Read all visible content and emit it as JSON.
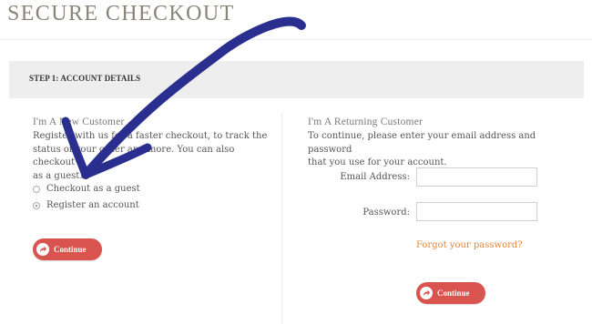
{
  "page": {
    "title": "SECURE CHECKOUT"
  },
  "step": {
    "label": "STEP 1: ACCOUNT DETAILS"
  },
  "new_customer": {
    "heading": "I'm A New Customer",
    "text_line1": "Register with us for a faster checkout, to track the",
    "text_line2": "status of your order and more. You can also checkout",
    "text_line3": "as a guest.",
    "options": [
      {
        "label": "Checkout as a guest",
        "checked": false
      },
      {
        "label": "Register an account",
        "checked": true
      }
    ],
    "continue_label": "Continue"
  },
  "returning_customer": {
    "heading": "I'm A Returning Customer",
    "text_line1": "To continue, please enter your email address and password",
    "text_line2": "that you use for your account.",
    "email_label": "Email Address:",
    "password_label": "Password:",
    "email_value": "",
    "password_value": "",
    "forgot_label": "Forgot your password?",
    "continue_label": "Continue"
  },
  "colors": {
    "button": "#d9534f",
    "link": "#e0873b",
    "annotation_arrow": "#2a2f8f",
    "step_bar": "#eeeeee"
  },
  "icons": {
    "continue_button": "redo-arrow-icon",
    "annotation": "hand-drawn-arrow"
  }
}
